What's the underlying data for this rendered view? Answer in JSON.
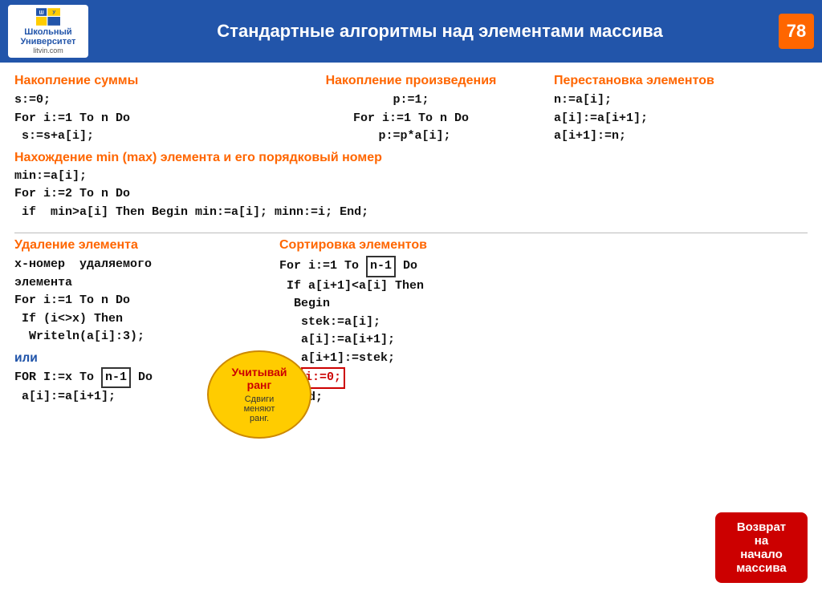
{
  "header": {
    "title": "Стандартные алгоритмы над элементами массива",
    "page_number": "78",
    "logo_top": "Школьный",
    "logo_mid": "Университет",
    "logo_bottom": "litvin.com"
  },
  "section_sum": {
    "title": "Накопление суммы",
    "code": [
      "s:=0;",
      "For i:=1 To n Do",
      " s:=s+a[i];"
    ]
  },
  "section_prod": {
    "title": "Накопление произведения",
    "code": [
      "p:=1;",
      "For i:=1 To n Do",
      " p:=p*a[i];"
    ]
  },
  "section_swap": {
    "title": "Перестановка элементов",
    "code": [
      "n:=a[i];",
      "a[i]:=a[i+1];",
      "a[i+1]:=n;"
    ]
  },
  "section_minmax": {
    "title": "Нахождение  min (max) элемента и его порядковый номер",
    "code": [
      "min:=a[i];",
      "For i:=2 To n Do",
      " if  min>a[i] Then Begin min:=a[i]; minn:=i; End;"
    ]
  },
  "section_delete": {
    "title": "Удаление элемента",
    "code_lines": [
      "x-номер  удаляемого",
      "элемента",
      "For i:=1 To n Do",
      " If (i<>x) Then",
      "  Writeln(a[i]:3);"
    ],
    "or_label": "или",
    "code_lines2": [
      "FOR I:=x To n-1 Do",
      " a[i]:=a[i+1];"
    ],
    "highlight_n1": "n-1"
  },
  "section_sort": {
    "title": "Сортировка элементов",
    "code_lines": [
      "For i:=1 To n-1 Do",
      " If a[i+1]<a[i] Then",
      "  Begin",
      "   stek:=a[i];",
      "   a[i]:=a[i+1];",
      "   a[i+1]:=stek;",
      "   i:=0;",
      "  End;"
    ],
    "highlight_n1": "n-1",
    "highlight_i0": "i:=0;"
  },
  "balloon_учитывай": {
    "line1": "Учитывай",
    "line2": "ранг",
    "sub": "Сдвиги\nменяют\nранг."
  },
  "balloon_возврат": {
    "text": "Возврат\nна\nначало\nмассива"
  }
}
